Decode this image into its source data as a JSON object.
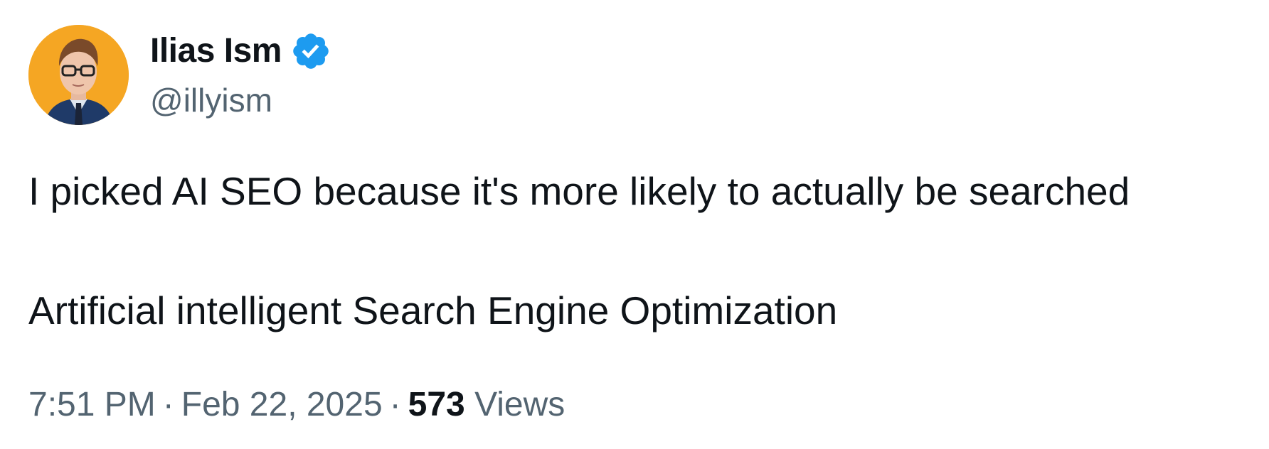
{
  "author": {
    "display_name": "Ilias Ism",
    "handle": "@illyism",
    "verified": true,
    "avatar_bg": "#f5a623",
    "verified_color": "#1d9bf0"
  },
  "tweet": {
    "line1": "I picked AI SEO because it's more likely to actually be searched",
    "line2": "Artificial intelligent Search Engine Optimization"
  },
  "meta": {
    "time": "7:51 PM",
    "date": "Feb 22, 2025",
    "separator": "·",
    "views_count": "573",
    "views_label": "Views"
  }
}
